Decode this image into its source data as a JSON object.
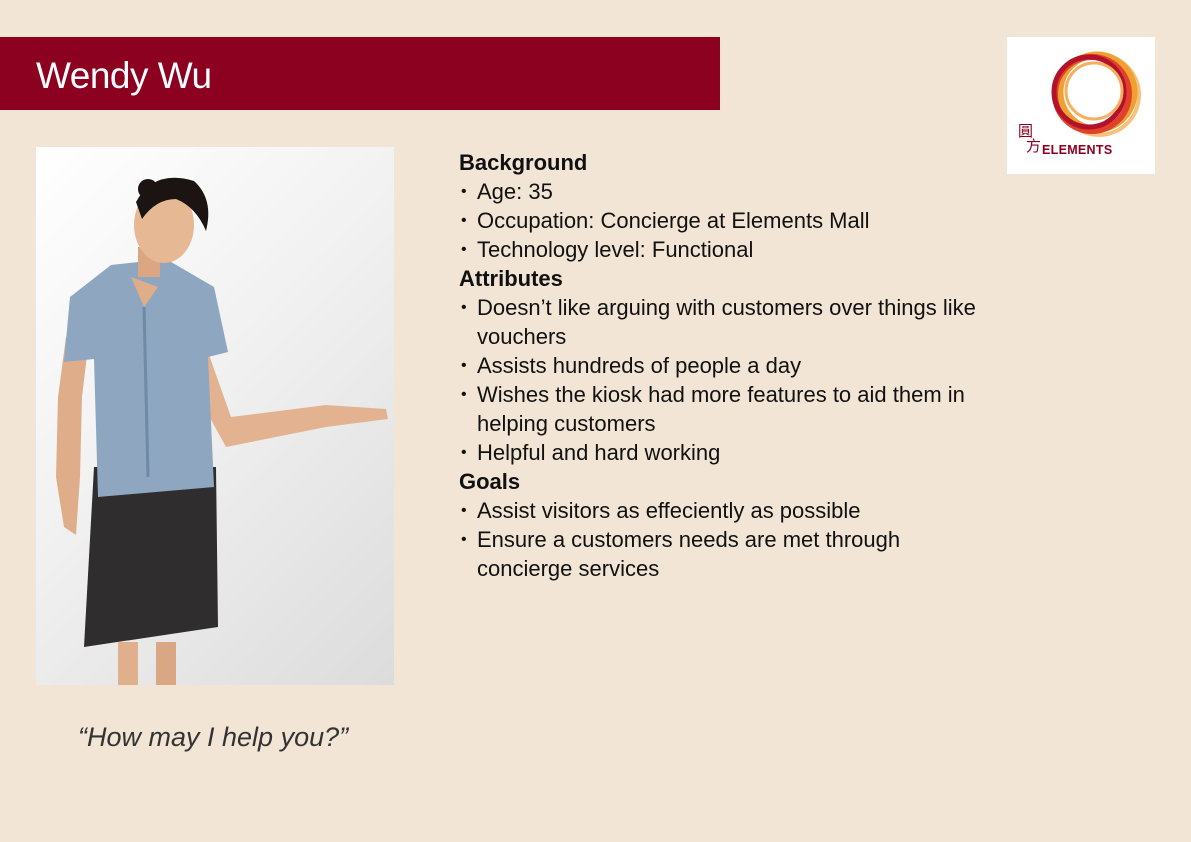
{
  "persona": {
    "name": "Wendy Wu",
    "quote": "“How may I help you?”"
  },
  "logo": {
    "text": "ELEMENTS",
    "chinese_top": "圓",
    "chinese_bottom": "方"
  },
  "sections": {
    "background": {
      "title": "Background",
      "items": [
        "Age: 35",
        "Occupation: Concierge at Elements Mall",
        "Technology level: Functional"
      ]
    },
    "attributes": {
      "title": "Attributes",
      "items": [
        "Doesn’t like arguing with customers over things like vouchers",
        "Assists hundreds of people a day",
        "Wishes the kiosk had more features to aid them in helping customers",
        "Helpful and hard working"
      ]
    },
    "goals": {
      "title": "Goals",
      "items": [
        "Assist visitors as effeciently as possible",
        "Ensure a customers needs are met through concierge services"
      ]
    }
  },
  "colors": {
    "background": "#f2e5d5",
    "accent": "#8c0020",
    "logo_orange": "#f0a030"
  }
}
